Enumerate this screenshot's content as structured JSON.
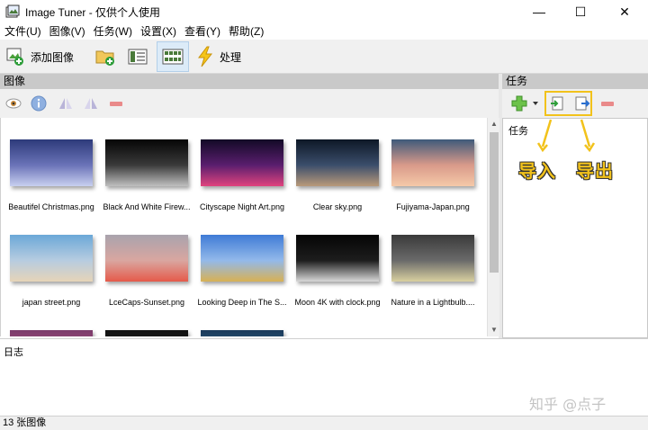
{
  "window": {
    "title": "Image Tuner - 仅供个人使用",
    "minimize_glyph": "—",
    "maximize_glyph": "☐",
    "close_glyph": "✕"
  },
  "menu": {
    "items": [
      "文件(U)",
      "图像(V)",
      "任务(W)",
      "设置(X)",
      "查看(Y)",
      "帮助(Z)"
    ]
  },
  "toolbar": {
    "add_images_label": "添加图像",
    "process_label": "处理",
    "icons": [
      "add-images-icon",
      "add-folder-icon",
      "list-view-icon",
      "thumbnail-view-icon",
      "process-lightning-icon"
    ]
  },
  "images_panel": {
    "header": "图像",
    "tool_icons": [
      "eye-icon",
      "info-icon",
      "flip-icon",
      "mirror-icon",
      "remove-icon"
    ],
    "items": [
      {
        "name": "Beautifel Christmas.png",
        "colors": [
          "#2d3a7a",
          "#6a73b8",
          "#c8d0f0"
        ]
      },
      {
        "name": "Black And White Firew...",
        "colors": [
          "#050505",
          "#3a3a3a",
          "#bfbfbf"
        ]
      },
      {
        "name": "Cityscape Night Art.png",
        "colors": [
          "#120a26",
          "#5a1e6e",
          "#e0447e"
        ]
      },
      {
        "name": "Clear sky.png",
        "colors": [
          "#0d1726",
          "#3b4e6b",
          "#b99a7a"
        ]
      },
      {
        "name": "Fujiyama-Japan.png",
        "colors": [
          "#3e5a7a",
          "#d99a8a",
          "#f5c9a8"
        ]
      },
      {
        "name": "japan street.png",
        "colors": [
          "#6ba8d8",
          "#b7cce0",
          "#e6d4b8"
        ]
      },
      {
        "name": "LceCaps-Sunset.png",
        "colors": [
          "#a9a3ad",
          "#d9a6a0",
          "#e55a4a"
        ]
      },
      {
        "name": "Looking Deep in The S...",
        "colors": [
          "#3f7bd6",
          "#93b9ea",
          "#d8b154"
        ]
      },
      {
        "name": "Moon 4K with clock.png",
        "colors": [
          "#050505",
          "#1d1d1d",
          "#d8d8d8"
        ]
      },
      {
        "name": "Nature in a Lightbulb....",
        "colors": [
          "#3a3a3a",
          "#6a6a6a",
          "#d9d0a0"
        ]
      },
      {
        "name": "",
        "colors": [
          "#7a3a6a",
          "#b45a8a",
          "#e0a0c0"
        ]
      },
      {
        "name": "",
        "colors": [
          "#101010",
          "#303030",
          "#505050"
        ]
      },
      {
        "name": "",
        "colors": [
          "#1a3a5a",
          "#3a6a8a",
          "#7aa0c0"
        ]
      }
    ]
  },
  "tasks_panel": {
    "header": "任务",
    "list_label": "任务",
    "tool_icons": [
      "add-task-icon",
      "dropdown-arrow-icon",
      "import-icon",
      "export-icon",
      "remove-task-icon"
    ]
  },
  "annotation": {
    "import_label": "导入",
    "export_label": "导出",
    "color": "#f2c21b"
  },
  "log_panel": {
    "label": "日志",
    "watermark": "知乎 @点子"
  },
  "status": {
    "text": "13 张图像"
  }
}
